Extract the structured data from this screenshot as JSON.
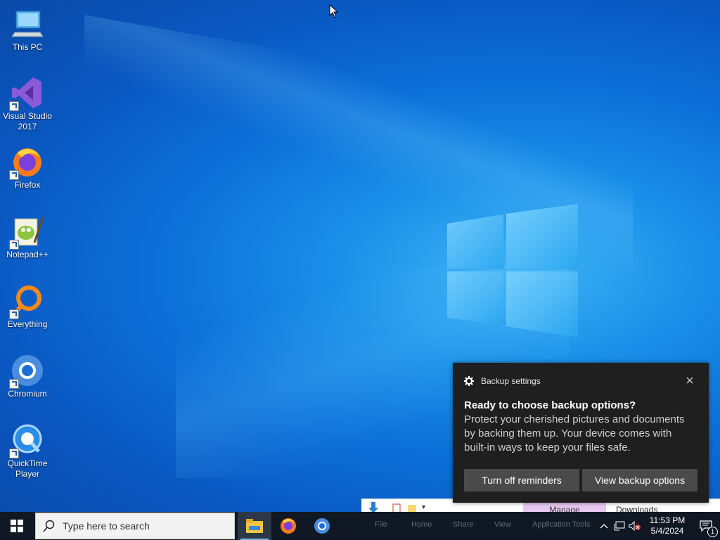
{
  "desktop": {
    "icons": [
      {
        "label": "This PC",
        "icon": "this-pc-icon"
      },
      {
        "label": "Visual Studio 2017",
        "icon": "visual-studio-icon"
      },
      {
        "label": "Firefox",
        "icon": "firefox-icon"
      },
      {
        "label": "Notepad++",
        "icon": "notepadpp-icon"
      },
      {
        "label": "Everything",
        "icon": "everything-icon"
      },
      {
        "label": "Chromium",
        "icon": "chromium-icon"
      },
      {
        "label": "QuickTime Player",
        "icon": "quicktime-icon"
      }
    ]
  },
  "explorer_peek": {
    "manage": "Manage",
    "location": "Downloads",
    "ribbon": [
      "File",
      "Home",
      "Share",
      "View",
      "Application Tools"
    ]
  },
  "notification": {
    "app": "Backup settings",
    "title": "Ready to choose backup options?",
    "body": "Protect your cherished pictures and documents by backing them up. Your device comes with built-in ways to keep your files safe.",
    "button1": "Turn off reminders",
    "button2": "View backup options"
  },
  "taskbar": {
    "search_placeholder": "Type here to search",
    "pinned": [
      "file-explorer-icon",
      "firefox-icon",
      "chromium-icon"
    ],
    "time": "11:53 PM",
    "date": "5/4/2024",
    "notification_count": "1"
  },
  "colors": {
    "desktop_accent": "#0c6fd8",
    "toast_bg": "#1f1f1f",
    "taskbar_bg": "#101824"
  }
}
